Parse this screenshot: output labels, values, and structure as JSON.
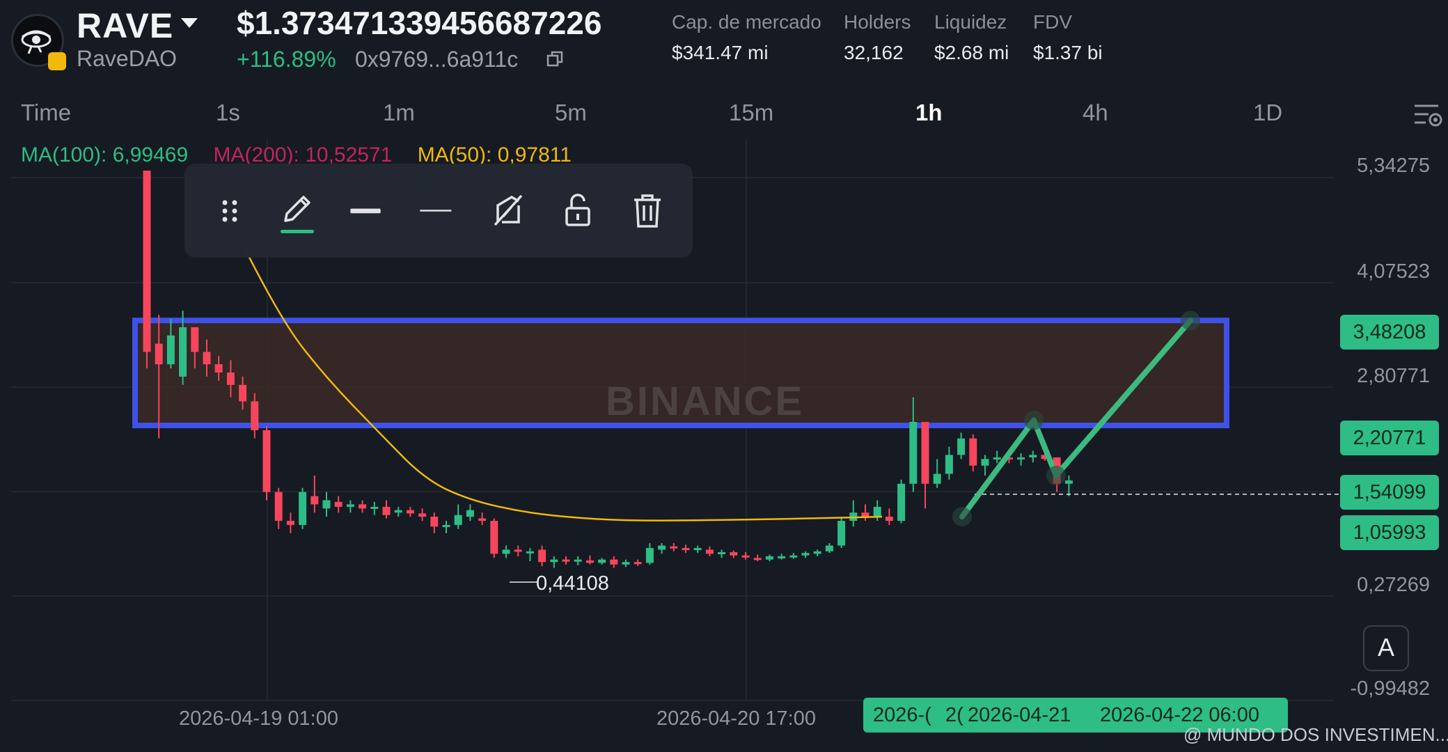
{
  "header": {
    "symbol": "RAVE",
    "name": "RaveDAO",
    "price": "$1.37347133945 6687226",
    "price_exact": "$1.373471339456687226",
    "change": "+116.89%",
    "address": "0x9769...6a911c",
    "stats": [
      {
        "label": "Cap. de mercado",
        "value": "$341.47 mi"
      },
      {
        "label": "Holders",
        "value": "32,162"
      },
      {
        "label": "Liquidez",
        "value": "$2.68 mi"
      },
      {
        "label": "FDV",
        "value": "$1.37 bi"
      }
    ]
  },
  "timeframes": [
    "Time",
    "1s",
    "1m",
    "5m",
    "15m",
    "1h",
    "4h",
    "1D"
  ],
  "active_timeframe": "1h",
  "moving_averages": [
    {
      "label": "MA(100): 6,99469",
      "color": "#2ebd85"
    },
    {
      "label": "MA(200): 10,52571",
      "color": "#c2255c"
    },
    {
      "label": "MA(50): 0,97811",
      "color": "#f0b90b"
    }
  ],
  "drawing_toolbar": {
    "tools": [
      "drag-handle-icon",
      "pencil-icon",
      "thick-line-icon",
      "thin-line-icon",
      "hide-drawing-icon",
      "unlock-icon",
      "trash-icon"
    ]
  },
  "colors": {
    "up": "#2ebd85",
    "down": "#f6465d",
    "zone_fill": "#3a2a26",
    "zone_border": "#3f51e6",
    "ma50": "#f0b90b",
    "background": "#161a22"
  },
  "watermark": "BINANCE",
  "low_label": "0,44108",
  "auto_button": "A",
  "credit": "@ MUNDO DOS INVESTIMEN...",
  "chart_data": {
    "type": "candlestick",
    "y_ticks": [
      "5,34275",
      "4,07523",
      "2,80771",
      "0,27269",
      "-0,99482"
    ],
    "y_badges": [
      "3,48208",
      "2,20771",
      "1,54099",
      "1,05993"
    ],
    "x_labels": [
      "2026-04-19 01:00",
      "2026-04-20 17:00"
    ],
    "cursor_labels": [
      "2026-(",
      "2(",
      "2026-04-21",
      "2026-04-22 06:00"
    ],
    "ylim": [
      -0.99482,
      5.34275
    ],
    "zone": [
      2.20771,
      3.48208
    ],
    "candles": [
      [
        5.3,
        5.3,
        2.9,
        3.1
      ],
      [
        3.2,
        3.55,
        2.05,
        2.95
      ],
      [
        2.95,
        3.5,
        2.9,
        3.3
      ],
      [
        2.8,
        3.6,
        2.7,
        3.4
      ],
      [
        3.4,
        3.4,
        2.9,
        3.1
      ],
      [
        3.1,
        3.25,
        2.8,
        2.95
      ],
      [
        2.95,
        3.05,
        2.75,
        2.85
      ],
      [
        2.85,
        3.0,
        2.55,
        2.7
      ],
      [
        2.7,
        2.8,
        2.4,
        2.5
      ],
      [
        2.5,
        2.6,
        2.05,
        2.15
      ],
      [
        2.15,
        2.2,
        1.3,
        1.4
      ],
      [
        1.4,
        1.45,
        0.95,
        1.05
      ],
      [
        1.05,
        1.15,
        0.9,
        1.0
      ],
      [
        1.0,
        1.45,
        0.95,
        1.4
      ],
      [
        1.35,
        1.6,
        1.15,
        1.25
      ],
      [
        1.2,
        1.4,
        1.1,
        1.3
      ],
      [
        1.28,
        1.35,
        1.15,
        1.22
      ],
      [
        1.22,
        1.3,
        1.15,
        1.25
      ],
      [
        1.25,
        1.3,
        1.15,
        1.2
      ],
      [
        1.2,
        1.28,
        1.12,
        1.22
      ],
      [
        1.22,
        1.3,
        1.08,
        1.12
      ],
      [
        1.15,
        1.22,
        1.1,
        1.18
      ],
      [
        1.18,
        1.22,
        1.1,
        1.14
      ],
      [
        1.14,
        1.2,
        1.05,
        1.1
      ],
      [
        1.1,
        1.15,
        0.9,
        0.98
      ],
      [
        0.98,
        1.05,
        0.9,
        1.0
      ],
      [
        1.0,
        1.25,
        0.95,
        1.12
      ],
      [
        1.1,
        1.25,
        1.05,
        1.18
      ],
      [
        1.08,
        1.15,
        1.0,
        1.05
      ],
      [
        1.05,
        1.08,
        0.6,
        0.65
      ],
      [
        0.65,
        0.75,
        0.6,
        0.7
      ],
      [
        0.7,
        0.75,
        0.62,
        0.68
      ],
      [
        0.66,
        0.72,
        0.56,
        0.68
      ],
      [
        0.7,
        0.75,
        0.5,
        0.55
      ],
      [
        0.55,
        0.62,
        0.48,
        0.58
      ],
      [
        0.58,
        0.62,
        0.52,
        0.56
      ],
      [
        0.56,
        0.62,
        0.51,
        0.58
      ],
      [
        0.57,
        0.63,
        0.52,
        0.54
      ],
      [
        0.54,
        0.6,
        0.52,
        0.58
      ],
      [
        0.58,
        0.62,
        0.48,
        0.52
      ],
      [
        0.52,
        0.58,
        0.49,
        0.55
      ],
      [
        0.55,
        0.58,
        0.5,
        0.54
      ],
      [
        0.54,
        0.78,
        0.52,
        0.72
      ],
      [
        0.7,
        0.78,
        0.65,
        0.75
      ],
      [
        0.74,
        0.78,
        0.68,
        0.72
      ],
      [
        0.72,
        0.76,
        0.66,
        0.7
      ],
      [
        0.7,
        0.75,
        0.66,
        0.72
      ],
      [
        0.7,
        0.74,
        0.62,
        0.65
      ],
      [
        0.65,
        0.7,
        0.6,
        0.67
      ],
      [
        0.67,
        0.69,
        0.6,
        0.63
      ],
      [
        0.63,
        0.67,
        0.58,
        0.62
      ],
      [
        0.6,
        0.64,
        0.56,
        0.58
      ],
      [
        0.58,
        0.64,
        0.56,
        0.62
      ],
      [
        0.6,
        0.65,
        0.58,
        0.62
      ],
      [
        0.62,
        0.66,
        0.59,
        0.63
      ],
      [
        0.63,
        0.68,
        0.6,
        0.66
      ],
      [
        0.65,
        0.7,
        0.62,
        0.68
      ],
      [
        0.68,
        0.78,
        0.66,
        0.75
      ],
      [
        0.75,
        1.1,
        0.72,
        1.05
      ],
      [
        1.05,
        1.3,
        0.98,
        1.15
      ],
      [
        1.15,
        1.25,
        1.05,
        1.1
      ],
      [
        1.1,
        1.3,
        1.05,
        1.22
      ],
      [
        1.1,
        1.2,
        1.0,
        1.05
      ],
      [
        1.05,
        1.55,
        1.02,
        1.5
      ],
      [
        1.5,
        2.55,
        1.4,
        2.25
      ],
      [
        2.25,
        2.25,
        1.2,
        1.5
      ],
      [
        1.5,
        1.8,
        1.45,
        1.62
      ],
      [
        1.62,
        1.95,
        1.55,
        1.85
      ],
      [
        1.85,
        2.12,
        1.8,
        2.05
      ],
      [
        2.05,
        2.1,
        1.65,
        1.72
      ],
      [
        1.72,
        1.85,
        1.6,
        1.8
      ],
      [
        1.8,
        1.9,
        1.75,
        1.82
      ],
      [
        1.82,
        1.88,
        1.75,
        1.8
      ],
      [
        1.8,
        1.87,
        1.72,
        1.82
      ],
      [
        1.82,
        1.9,
        1.76,
        1.85
      ],
      [
        1.85,
        1.9,
        1.78,
        1.8
      ],
      [
        1.82,
        1.82,
        1.4,
        1.5
      ],
      [
        1.5,
        1.6,
        1.35,
        1.54
      ]
    ],
    "ma50_line": [
      [
        4.3,
        4.5
      ],
      [
        3.5,
        6.0
      ],
      [
        2.8,
        8.0
      ],
      [
        2.1,
        10.5
      ],
      [
        1.55,
        12.5
      ],
      [
        1.3,
        14.5
      ],
      [
        1.15,
        17.0
      ],
      [
        1.08,
        19.5
      ],
      [
        1.05,
        22.0
      ],
      [
        1.06,
        26.0
      ],
      [
        1.08,
        30.0
      ],
      [
        1.1,
        33.0
      ]
    ],
    "projection": [
      1.1,
      2.27,
      1.6,
      3.48
    ]
  }
}
